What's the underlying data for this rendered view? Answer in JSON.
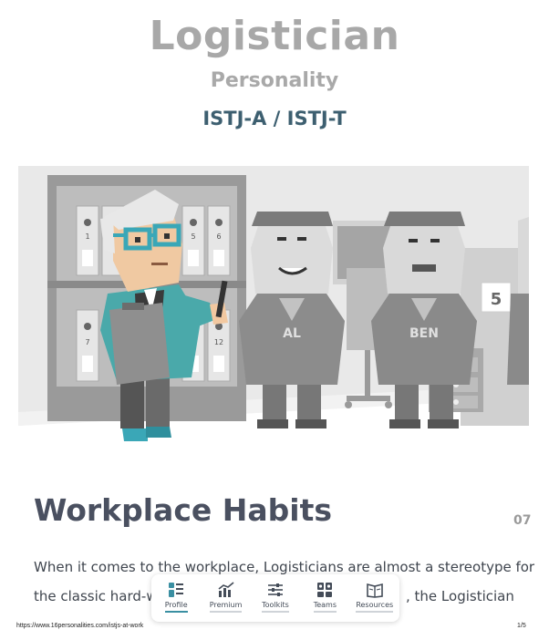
{
  "header": {
    "title": "Logistician",
    "subtitle": "Personality",
    "code": "ISTJ-A / ISTJ-T"
  },
  "illustration": {
    "drawer_numbers": [
      "1",
      "5",
      "6",
      "7",
      "12"
    ],
    "sign_number": "5",
    "figure_labels": [
      "AL",
      "BEN"
    ]
  },
  "section": {
    "title": "Workplace Habits",
    "number": "07",
    "paragraph_line1": "When it comes to the workplace, Logisticians are almost a stereotype for",
    "paragraph_line2a": "the classic hard-wo",
    "paragraph_line2b": ", the Logistician"
  },
  "nav": {
    "items": [
      {
        "label": "Profile",
        "icon": "profile-icon"
      },
      {
        "label": "Premium",
        "icon": "chart-icon"
      },
      {
        "label": "Toolkits",
        "icon": "sliders-icon"
      },
      {
        "label": "Teams",
        "icon": "team-icon"
      },
      {
        "label": "Resources",
        "icon": "book-icon"
      }
    ],
    "active": "Profile",
    "accent_color": "#3a8fa2"
  },
  "footer": {
    "url": "https://www.16personalities.com/istjs-at-work",
    "page": "1/5"
  }
}
